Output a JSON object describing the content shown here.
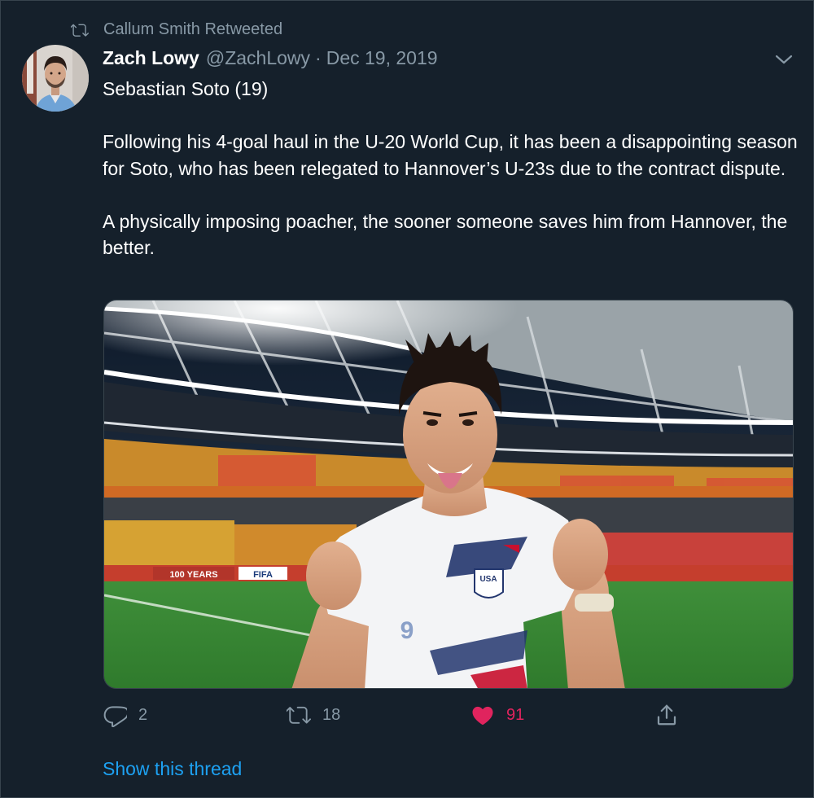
{
  "retweet": {
    "icon": "retweet-icon",
    "text": "Callum Smith Retweeted"
  },
  "author": {
    "display_name": "Zach Lowy",
    "handle": "@ZachLowy",
    "separator": "·",
    "date": "Dec 19, 2019"
  },
  "tweet": {
    "line1": "Sebastian Soto (19)",
    "para2": "Following his 4-goal haul in the U-20 World Cup, it has been a disappointing season for Soto, who has been relegated to Hannover’s U-23s due to the contract dispute.",
    "para3": "A physically imposing poacher, the sooner someone saves him from Hannover, the better."
  },
  "media": {
    "jersey_badge": "USA",
    "jersey_number": "9",
    "board_text_1": "100 YEARS",
    "board_text_2": "FIFA"
  },
  "actions": {
    "reply_count": "2",
    "retweet_count": "18",
    "like_count": "91"
  },
  "links": {
    "show_thread": "Show this thread"
  },
  "colors": {
    "background": "#15202b",
    "muted": "#8899a6",
    "link": "#1da1f2",
    "like": "#e0245e"
  }
}
